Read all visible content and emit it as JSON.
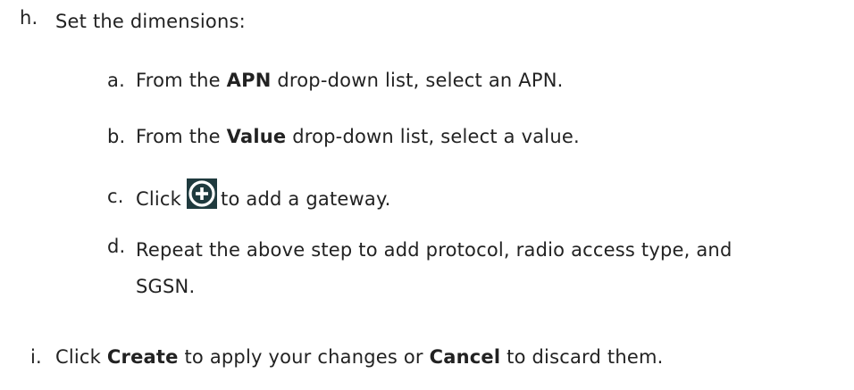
{
  "steps": {
    "h": {
      "marker": "h.",
      "text": "Set the dimensions:"
    },
    "a": {
      "marker": "a.",
      "pre": "From the ",
      "bold": "APN",
      "post": " drop-down list, select an APN."
    },
    "b": {
      "marker": "b.",
      "pre": "From the ",
      "bold": "Value",
      "post": " drop-down list, select a value."
    },
    "c": {
      "marker": "c.",
      "pre": "Click",
      "icon": "add-circle-icon",
      "post": "to add a gateway."
    },
    "d": {
      "marker": "d.",
      "line1": "Repeat the above step to add protocol, radio access type, and",
      "line2": "SGSN."
    },
    "i": {
      "marker": "i.",
      "pre": "Click ",
      "bold1": "Create",
      "mid": " to apply your changes or ",
      "bold2": "Cancel",
      "post": " to discard them."
    }
  },
  "colors": {
    "text": "#222222",
    "icon_bg": "#1f3a3e",
    "icon_fg": "#ffffff"
  }
}
